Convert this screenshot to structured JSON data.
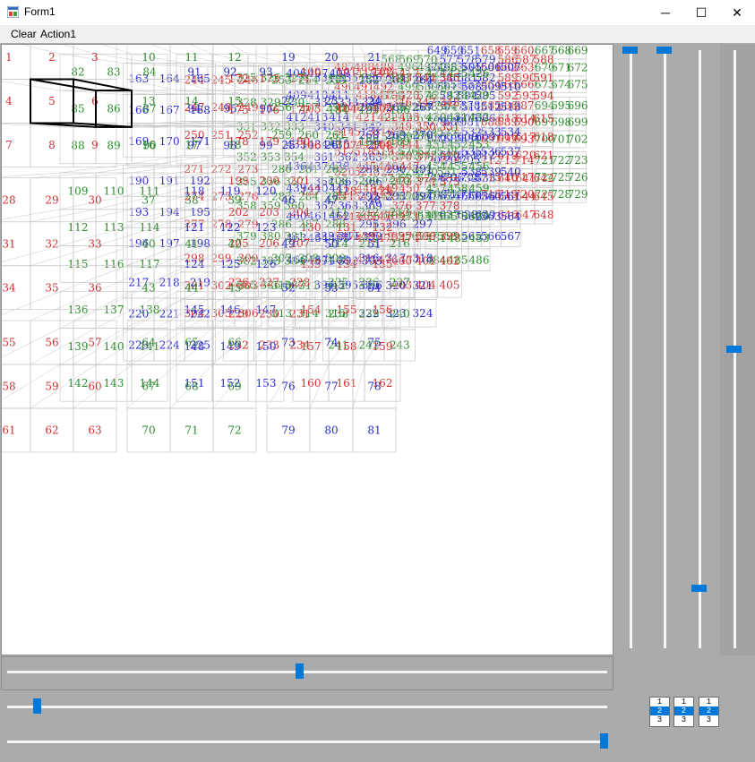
{
  "window": {
    "title": "Form1",
    "controls": {
      "minimize": "─",
      "maximize": "☐",
      "close": "✕"
    }
  },
  "menu": {
    "items": [
      "Clear",
      "Action1"
    ]
  },
  "scene": {
    "colors": {
      "red": "#d32f2f",
      "green": "#2e8b2e",
      "blue": "#2a2ad0",
      "grid": "#c8c8c8",
      "selection": "#000000"
    },
    "cell_labels": [
      "1",
      "2",
      "3",
      "4",
      "5",
      "6",
      "7",
      "8",
      "9",
      "10",
      "11",
      "12",
      "13",
      "14",
      "15",
      "16",
      "17",
      "18",
      "19",
      "20",
      "21",
      "22",
      "23",
      "24",
      "25",
      "26",
      "27",
      "28",
      "29",
      "30",
      "31",
      "32",
      "33",
      "34",
      "35",
      "36",
      "37",
      "38",
      "39",
      "40",
      "41",
      "42",
      "43",
      "44",
      "45",
      "46",
      "47",
      "48",
      "49",
      "50",
      "51",
      "52",
      "53",
      "54",
      "55",
      "56",
      "57",
      "58",
      "59",
      "60",
      "61",
      "62",
      "63",
      "64",
      "65",
      "66",
      "67",
      "68",
      "69",
      "70",
      "71",
      "72",
      "73",
      "74",
      "75",
      "76",
      "77",
      "78",
      "79",
      "80",
      "81",
      "82",
      "83",
      "84",
      "85",
      "86",
      "87",
      "88",
      "89",
      "90",
      "91",
      "92",
      "93",
      "94",
      "95",
      "96",
      "97",
      "98",
      "99",
      "100",
      "101",
      "102",
      "103",
      "104",
      "105",
      "106",
      "107",
      "108",
      "109",
      "110",
      "111",
      "112",
      "113",
      "114",
      "115",
      "116",
      "117",
      "118",
      "119",
      "120",
      "121",
      "122",
      "123",
      "124",
      "125",
      "126",
      "127",
      "128",
      "129",
      "130",
      "131",
      "132",
      "133",
      "134",
      "135",
      "136",
      "137",
      "138",
      "139",
      "140",
      "141",
      "142",
      "143",
      "144",
      "145",
      "146",
      "147",
      "148",
      "149",
      "150",
      "151",
      "152",
      "153",
      "154",
      "155",
      "156",
      "157",
      "158",
      "159",
      "160",
      "161",
      "162",
      "163",
      "164",
      "165",
      "166",
      "167",
      "168",
      "169",
      "170",
      "171",
      "172",
      "173",
      "174",
      "175",
      "176",
      "177",
      "178",
      "179",
      "180",
      "181",
      "182",
      "183",
      "184",
      "185",
      "186",
      "187",
      "188",
      "189",
      "190",
      "191",
      "192",
      "193",
      "194",
      "195",
      "196",
      "197",
      "198",
      "199",
      "200",
      "201",
      "202",
      "203",
      "204",
      "205",
      "206",
      "207",
      "208",
      "209",
      "210",
      "211",
      "212",
      "213",
      "214",
      "215",
      "216",
      "217",
      "218",
      "219",
      "220",
      "221",
      "222",
      "223",
      "224",
      "225",
      "226",
      "227",
      "228",
      "229",
      "230",
      "231",
      "232",
      "233",
      "234",
      "235",
      "236",
      "237",
      "238",
      "239",
      "240",
      "241",
      "242",
      "243",
      "244",
      "245",
      "246",
      "247",
      "248",
      "249",
      "250",
      "251",
      "252",
      "253",
      "254",
      "255",
      "256",
      "257",
      "258",
      "259",
      "260",
      "261",
      "262",
      "263",
      "264",
      "265",
      "266",
      "267",
      "268",
      "269",
      "270",
      "271",
      "272",
      "273",
      "274",
      "275",
      "276",
      "277",
      "278",
      "279",
      "280",
      "281",
      "282",
      "283",
      "284",
      "285",
      "286",
      "287",
      "288",
      "289",
      "290",
      "291",
      "292",
      "293",
      "294",
      "295",
      "296",
      "297",
      "298",
      "299",
      "300",
      "301",
      "302",
      "303",
      "304",
      "305",
      "306",
      "307",
      "308",
      "309",
      "310",
      "311",
      "312",
      "313",
      "314",
      "315",
      "316",
      "317",
      "318",
      "319",
      "320",
      "321",
      "322",
      "323",
      "324",
      "325",
      "326",
      "327",
      "328",
      "329",
      "330",
      "331",
      "332",
      "333",
      "334",
      "335",
      "336",
      "337",
      "338",
      "339",
      "340",
      "341",
      "342",
      "343",
      "344",
      "345",
      "346",
      "347",
      "348",
      "349",
      "350",
      "351",
      "352",
      "353",
      "354",
      "355",
      "356",
      "357",
      "358",
      "359",
      "360",
      "361",
      "362",
      "363",
      "364",
      "365",
      "366",
      "367",
      "368",
      "369",
      "370",
      "371",
      "372",
      "373",
      "374",
      "375",
      "376",
      "377",
      "378",
      "379",
      "380",
      "381",
      "382",
      "383",
      "384",
      "385",
      "386",
      "387",
      "388",
      "389",
      "390",
      "391",
      "392",
      "393",
      "394",
      "395",
      "396",
      "397",
      "398",
      "399",
      "400",
      "401",
      "402",
      "403",
      "404",
      "405",
      "406",
      "407",
      "408",
      "409",
      "410",
      "411",
      "412",
      "413",
      "414",
      "415",
      "416",
      "417",
      "418",
      "419",
      "420",
      "421",
      "422",
      "423",
      "424",
      "425",
      "426",
      "427",
      "428",
      "429",
      "430",
      "431",
      "432",
      "433",
      "434",
      "435",
      "436",
      "437",
      "438",
      "439",
      "440",
      "441",
      "442",
      "443",
      "444",
      "445",
      "446",
      "447",
      "448",
      "449",
      "450",
      "451",
      "452",
      "453",
      "454",
      "455",
      "456",
      "457",
      "458",
      "459",
      "460",
      "461",
      "462",
      "463",
      "464",
      "465",
      "466",
      "467",
      "468",
      "469",
      "470",
      "471",
      "472",
      "473",
      "474",
      "475",
      "476",
      "477",
      "478",
      "479",
      "480",
      "481",
      "482",
      "483",
      "484",
      "485",
      "486",
      "487",
      "488",
      "489",
      "490",
      "491",
      "492",
      "493",
      "494",
      "495",
      "496",
      "497",
      "498",
      "499",
      "500",
      "501",
      "502",
      "503",
      "504",
      "505",
      "506",
      "507",
      "508",
      "509",
      "510",
      "511",
      "512",
      "513",
      "514",
      "515",
      "516",
      "517",
      "518",
      "519",
      "520",
      "521",
      "522",
      "523",
      "524",
      "525",
      "526",
      "527",
      "528",
      "529",
      "530",
      "531",
      "532",
      "533",
      "534",
      "535",
      "536",
      "537",
      "538",
      "539",
      "540",
      "541",
      "542",
      "543",
      "544",
      "545",
      "546",
      "547",
      "548",
      "549",
      "550",
      "551",
      "552",
      "553",
      "554",
      "555",
      "556",
      "557",
      "558",
      "559",
      "560",
      "561",
      "562",
      "563",
      "564",
      "565",
      "566",
      "567",
      "568",
      "569",
      "570",
      "571",
      "572",
      "573",
      "574",
      "575",
      "576",
      "577",
      "578",
      "579",
      "580",
      "581",
      "582",
      "583",
      "584",
      "585",
      "586",
      "587",
      "588",
      "589",
      "590",
      "591",
      "592",
      "593",
      "594",
      "595",
      "596",
      "597",
      "598",
      "599",
      "600",
      "601",
      "602",
      "603",
      "604",
      "605",
      "606",
      "607",
      "608",
      "609",
      "610",
      "611",
      "612",
      "613",
      "614",
      "615",
      "616",
      "617",
      "618",
      "619",
      "620",
      "621",
      "622",
      "623",
      "624",
      "625",
      "626",
      "627",
      "628",
      "629",
      "630",
      "631",
      "632",
      "633",
      "634",
      "635",
      "636",
      "637",
      "638",
      "639",
      "640",
      "641",
      "642",
      "643",
      "644",
      "645",
      "646",
      "647",
      "648",
      "649",
      "650",
      "651",
      "652",
      "653",
      "654",
      "655",
      "656",
      "657",
      "658",
      "659",
      "660",
      "661",
      "662",
      "663",
      "664",
      "665",
      "666",
      "667",
      "668",
      "669",
      "670",
      "671",
      "672",
      "673",
      "674",
      "675",
      "676",
      "677",
      "678",
      "679",
      "680",
      "681",
      "682",
      "683",
      "684",
      "685",
      "686",
      "687",
      "688",
      "689",
      "690",
      "691",
      "692",
      "693",
      "694",
      "695",
      "696",
      "697",
      "698",
      "699",
      "700",
      "701",
      "702",
      "703",
      "704",
      "705",
      "706",
      "707",
      "708",
      "709",
      "710",
      "711",
      "712",
      "713",
      "714",
      "715",
      "716",
      "717",
      "718",
      "719",
      "720",
      "721",
      "722",
      "723",
      "724",
      "725",
      "726",
      "727",
      "728",
      "729"
    ]
  },
  "sliders": {
    "vertical": [
      {
        "name": "v-slider-1",
        "value": 1.0
      },
      {
        "name": "v-slider-2",
        "value": 1.0
      },
      {
        "name": "v-slider-3",
        "value": 0.1
      },
      {
        "name": "v-slider-4",
        "value": 0.5
      }
    ],
    "horizontal": [
      {
        "name": "h-slider-1",
        "value": 0.49
      },
      {
        "name": "h-slider-2",
        "value": 0.05
      },
      {
        "name": "h-slider-3",
        "value": 1.0
      }
    ]
  },
  "listboxes": [
    {
      "items": [
        "1",
        "2",
        "3"
      ],
      "selected": 1
    },
    {
      "items": [
        "1",
        "2",
        "3"
      ],
      "selected": 1
    },
    {
      "items": [
        "1",
        "2",
        "3"
      ],
      "selected": 1
    }
  ]
}
